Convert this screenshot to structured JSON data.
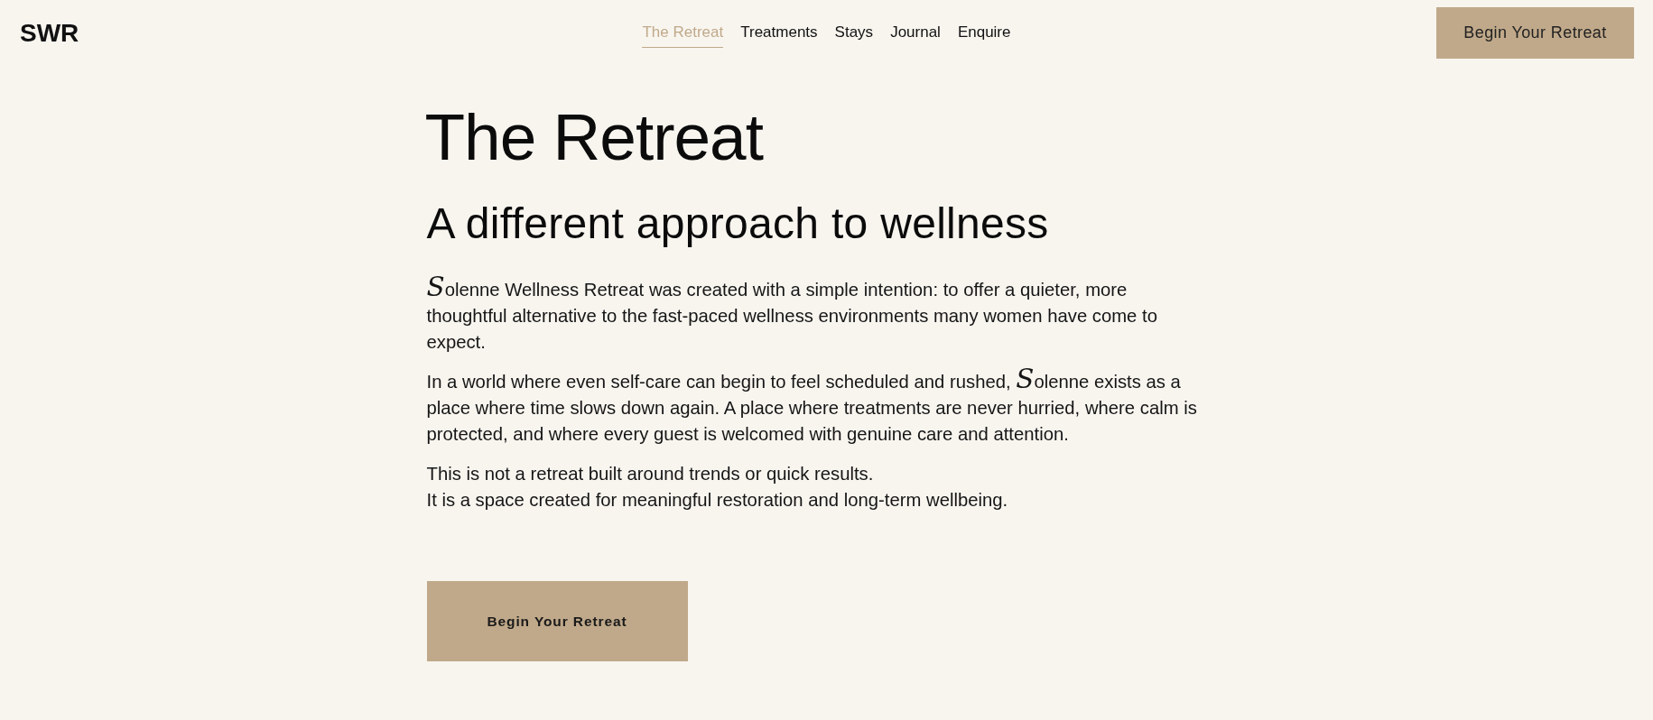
{
  "header": {
    "logo": "SWR",
    "nav": [
      {
        "label": "The Retreat",
        "selected": true
      },
      {
        "label": "Treatments",
        "selected": false
      },
      {
        "label": "Stays",
        "selected": false
      },
      {
        "label": "Journal",
        "selected": false
      },
      {
        "label": "Enquire",
        "selected": false
      }
    ],
    "cta": "Begin Your Retreat"
  },
  "main": {
    "title": "The Retreat",
    "subtitle": "A different approach to wellness",
    "paragraphs": [
      [
        {
          "text": "S",
          "script": true
        },
        {
          "text": "olenne Wellness Retreat was created with a simple intention: to offer a quieter, more thoughtful alternative to the fast-paced wellness environments many women have come to expect.",
          "script": false
        }
      ],
      [
        {
          "text": "In a world where even self-care can begin to feel scheduled and rushed, ",
          "script": false
        },
        {
          "text": "S",
          "script": true
        },
        {
          "text": "olenne exists as a place where time slows down again. A place where treatments are never hurried, where calm is protected, and where every guest is welcomed with genuine care and attention.",
          "script": false
        }
      ],
      [
        {
          "text": "This is not a retreat built around trends or quick results.\nIt is a space created for meaningful restoration and long-term wellbeing.",
          "script": false
        }
      ]
    ],
    "cta": "Begin Your Retreat"
  }
}
